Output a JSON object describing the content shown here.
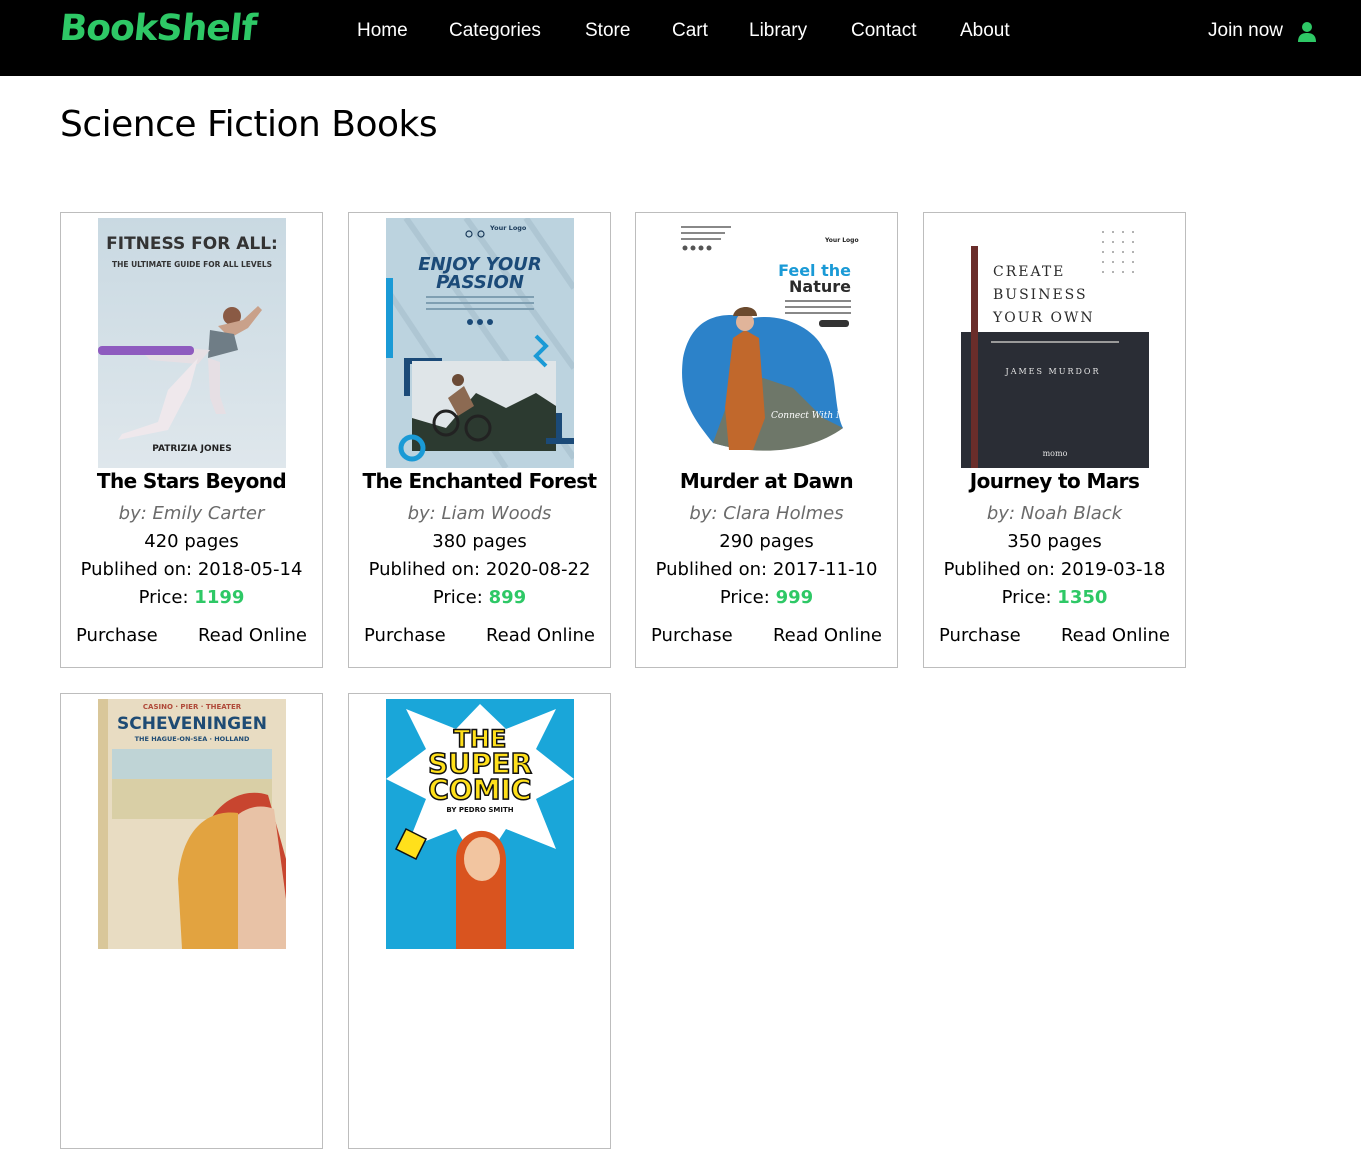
{
  "header": {
    "logo": "BookShelf",
    "nav": [
      "Home",
      "Categories",
      "Store",
      "Cart",
      "Library",
      "Contact",
      "About"
    ],
    "join_label": "Join now",
    "accent": "#2ec866"
  },
  "page": {
    "title": "Science Fiction Books"
  },
  "labels": {
    "by": "by:",
    "pages_suffix": "pages",
    "published_prefix": "Publihed on:",
    "price_prefix": "Price:",
    "purchase": "Purchase",
    "read_online": "Read Online"
  },
  "books": [
    {
      "title": "The Stars Beyond",
      "author": "Emily Carter",
      "pages": "420",
      "published": "2018-05-14",
      "price": "1199",
      "cover": {
        "headline": "FITNESS FOR ALL:",
        "subline": "THE ULTIMATE GUIDE FOR ALL LEVELS",
        "footer": "PATRIZIA JONES"
      }
    },
    {
      "title": "The Enchanted Forest",
      "author": "Liam Woods",
      "pages": "380",
      "published": "2020-08-22",
      "price": "899",
      "cover": {
        "logo": "Your Logo",
        "headline_1": "ENJOY YOUR",
        "headline_2": "PASSION"
      }
    },
    {
      "title": "Murder at Dawn",
      "author": "Clara Holmes",
      "pages": "290",
      "published": "2017-11-10",
      "price": "999",
      "cover": {
        "logo": "Your Logo",
        "headline_1": "Feel the",
        "headline_2": "Nature",
        "tagline": "Connect With Nature"
      }
    },
    {
      "title": "Journey to Mars",
      "author": "Noah Black",
      "pages": "350",
      "published": "2019-03-18",
      "price": "1350",
      "cover": {
        "line_1": "CREATE",
        "line_2": "BUSINESS",
        "line_3": "YOUR OWN",
        "author": "JAMES MURDOR",
        "footer": "momo"
      }
    },
    {
      "cover": {
        "top": "CASINO · PIER · THEATER",
        "headline": "SCHEVENINGEN",
        "subline": "THE HAGUE-ON-SEA · HOLLAND"
      }
    },
    {
      "cover": {
        "headline_1": "THE",
        "headline_2": "SUPER",
        "headline_3": "COMIC",
        "byline": "BY PEDRO SMITH"
      }
    }
  ]
}
